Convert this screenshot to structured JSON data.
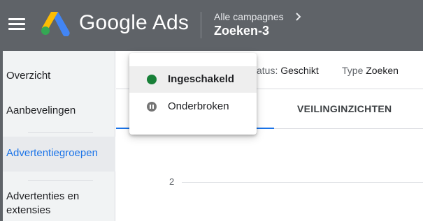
{
  "header": {
    "product_name": "Google Ads",
    "breadcrumb_parent": "Alle campagnes",
    "breadcrumb_current": "Zoeken-3",
    "background": "#5f6368"
  },
  "sidebar": {
    "items": [
      {
        "label": "Overzicht",
        "active": false
      },
      {
        "label": "Aanbevelingen",
        "active": false
      },
      {
        "label": "Advertentiegroepen",
        "active": true
      },
      {
        "label": "Advertenties en",
        "label_line2": "extensies",
        "active": false
      }
    ],
    "active_color": "#1a73e8"
  },
  "campaign_info": {
    "status_label": "atus:",
    "status_value": "Geschikt",
    "type_label": "Type",
    "type_value": "Zoeken"
  },
  "tabs": [
    {
      "label": "VEILINGINZICHTEN"
    }
  ],
  "chart": {
    "y_tick": "2"
  },
  "status_dropdown": {
    "options": [
      {
        "label": "Ingeschakeld",
        "icon": "green-dot-icon",
        "color": "#188038",
        "selected": true
      },
      {
        "label": "Onderbroken",
        "icon": "pause-icon",
        "color": "#757575",
        "selected": false
      }
    ]
  }
}
